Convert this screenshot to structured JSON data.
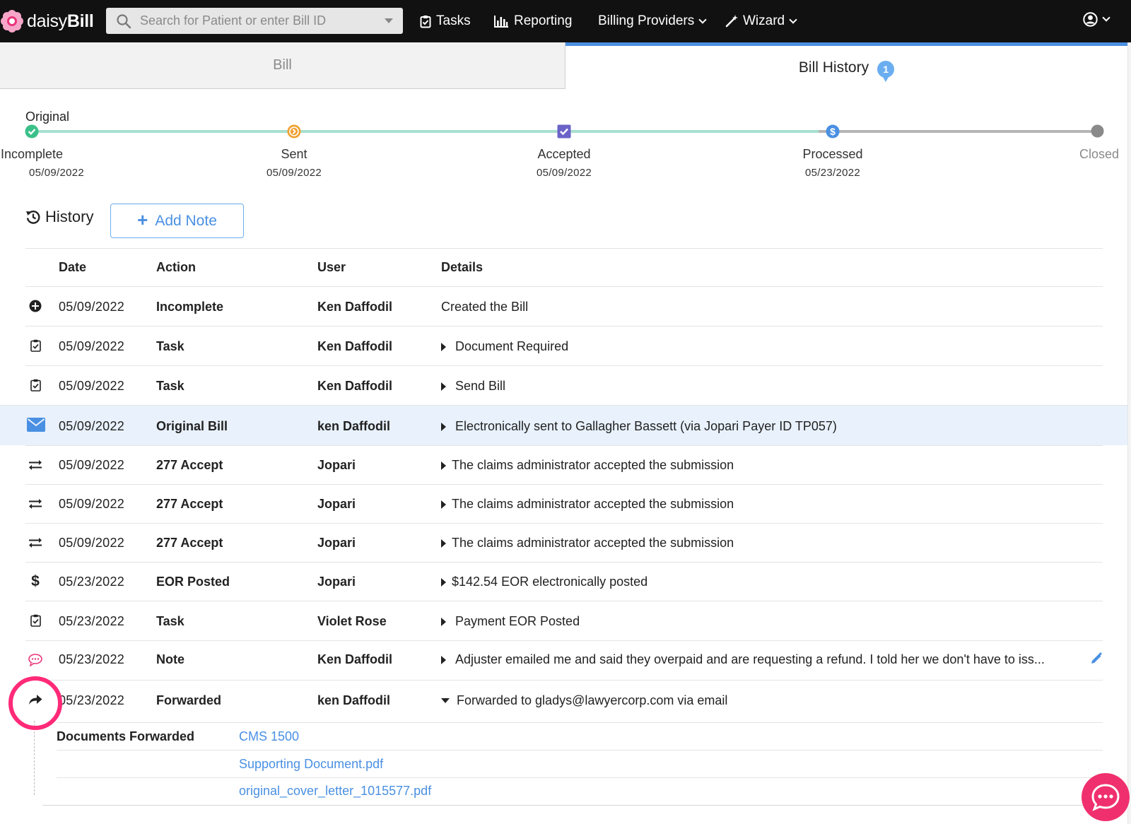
{
  "brand": {
    "name_light": "daisy",
    "name_bold": "Bill"
  },
  "search": {
    "placeholder": "Search for Patient or enter Bill ID"
  },
  "nav": {
    "tasks": "Tasks",
    "reporting": "Reporting",
    "billing_providers": "Billing Providers",
    "wizard": "Wizard"
  },
  "tabs": {
    "bill": "Bill",
    "history": "Bill History",
    "history_badge": "1"
  },
  "progress": {
    "label": "Original",
    "steps": [
      {
        "name": "Incomplete",
        "date": "05/09/2022"
      },
      {
        "name": "Sent",
        "date": "05/09/2022"
      },
      {
        "name": "Accepted",
        "date": "05/09/2022"
      },
      {
        "name": "Processed",
        "date": "05/23/2022"
      },
      {
        "name": "Closed",
        "date": ""
      }
    ]
  },
  "history": {
    "title": "History",
    "add_note": "Add Note",
    "columns": {
      "date": "Date",
      "action": "Action",
      "user": "User",
      "details": "Details"
    },
    "rows": [
      {
        "icon": "plus-circle-icon",
        "date": "05/09/2022",
        "action": "Incomplete",
        "user": "Ken Daffodil",
        "details": "Created the Bill"
      },
      {
        "icon": "clipboard-check-icon",
        "date": "05/09/2022",
        "action": "Task",
        "user": "Ken Daffodil",
        "details": "Document Required"
      },
      {
        "icon": "clipboard-check-icon",
        "date": "05/09/2022",
        "action": "Task",
        "user": "Ken Daffodil",
        "details": "Send Bill"
      },
      {
        "icon": "envelope-icon",
        "date": "05/09/2022",
        "action": "Original Bill",
        "user": "ken Daffodil",
        "details": "Electronically sent to Gallagher Bassett (via Jopari Payer ID TP057)"
      },
      {
        "icon": "exchange-icon",
        "date": "05/09/2022",
        "action": "277 Accept",
        "user": "Jopari",
        "details": "The claims administrator accepted the submission"
      },
      {
        "icon": "exchange-icon",
        "date": "05/09/2022",
        "action": "277 Accept",
        "user": "Jopari",
        "details": "The claims administrator accepted the submission"
      },
      {
        "icon": "exchange-icon",
        "date": "05/09/2022",
        "action": "277 Accept",
        "user": "Jopari",
        "details": "The claims administrator accepted the submission"
      },
      {
        "icon": "dollar-icon",
        "date": "05/23/2022",
        "action": "EOR Posted",
        "user": "Jopari",
        "details": "$142.54 EOR electronically posted"
      },
      {
        "icon": "clipboard-check-icon",
        "date": "05/23/2022",
        "action": "Task",
        "user": "Violet Rose",
        "details": "Payment EOR Posted"
      },
      {
        "icon": "speech-bubble-icon",
        "date": "05/23/2022",
        "action": "Note",
        "user": "Ken Daffodil",
        "details": "Adjuster emailed me and said they overpaid and are requesting a refund. I told her we don't have to iss..."
      },
      {
        "icon": "share-arrow-icon",
        "date": "05/23/2022",
        "action": "Forwarded",
        "user": "ken Daffodil",
        "details": "Forwarded to gladys@lawyercorp.com via email"
      }
    ],
    "documents_forwarded": {
      "label": "Documents Forwarded",
      "files": [
        "CMS 1500",
        "Supporting Document.pdf",
        "original_cover_letter_1015577.pdf"
      ]
    }
  },
  "colors": {
    "accent": "#4a90e2",
    "highlight_ring": "#ff2a78",
    "chat": "#f0306e",
    "track_done": "#a8dfcf",
    "track_pending": "#b5b5b5"
  }
}
